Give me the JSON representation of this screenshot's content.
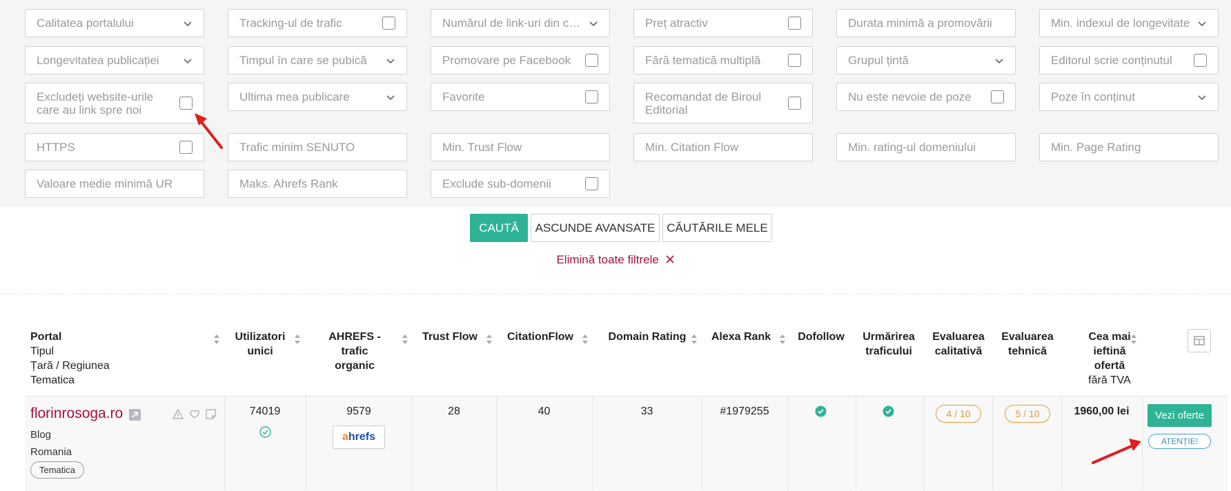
{
  "filters": {
    "row1": [
      "Calitatea portalului",
      "Tracking-ul de trafic",
      "Numărul de link-uri din co...",
      "Preț atractiv",
      "Durata minimă a promovării",
      "Min. indexul de longevitate"
    ],
    "row2": [
      "Longevitatea publicației",
      "Timpul în care se pubică",
      "Promovare pe Facebook",
      "Fără tematică multiplă",
      "Grupul țintă",
      "Editorul scrie conținutul"
    ],
    "row3": [
      "Excludeți website-urile care au link spre noi",
      "Ultima mea publicare",
      "Favorite",
      "Recomandat de Biroul Editorial",
      "Nu este nevoie de poze",
      "Poze în conținut"
    ],
    "row4": [
      "HTTPS",
      "Trafic minim SENUTO",
      "Min. Trust Flow",
      "Min. Citation Flow",
      "Min. rating-ul domeniului",
      "Min. Page Rating"
    ],
    "row5": [
      "Valoare medie minimă UR",
      "Maks. Ahrefs Rank",
      "Exclude sub-domenii"
    ]
  },
  "actions": {
    "search": "CAUTĂ",
    "hide_advanced": "ASCUNDE AVANSATE",
    "my_searches": "CĂUTĂRILE MELE",
    "clear_filters": "Elimină toate filtrele"
  },
  "table": {
    "headers": {
      "portal": "Portal",
      "type": "Tipul",
      "country": "Țară / Regiunea",
      "topic": "Tematica",
      "unique_users_1": "Utilizatori",
      "unique_users_2": "unici",
      "ahrefs_1": "AHREFS - trafic",
      "ahrefs_2": "organic",
      "trust_flow": "Trust Flow",
      "citation_flow": "CitationFlow",
      "domain_rating": "Domain Rating",
      "alexa": "Alexa Rank",
      "dofollow": "Dofollow",
      "tracking_1": "Urmărirea",
      "tracking_2": "traficului",
      "quality_1": "Evaluarea",
      "quality_2": "calitativă",
      "technical_1": "Evaluarea",
      "technical_2": "tehnică",
      "price_1": "Cea mai",
      "price_2": "ieftină",
      "price_3": "ofertă",
      "price_4": "fără TVA"
    },
    "row": {
      "portal": "florinrosoga.ro",
      "type": "Blog",
      "country": "Romania",
      "topic_tag": "Tematica",
      "unique_users": "74019",
      "ahrefs_traffic": "9579",
      "ahrefs_logo_a": "a",
      "ahrefs_logo_rest": "hrefs",
      "trust_flow": "28",
      "citation_flow": "40",
      "domain_rating": "33",
      "alexa": "#1979255",
      "quality": "4 / 10",
      "technical": "5 / 10",
      "price": "1960,00 lei",
      "offers_button": "Vezi oferte",
      "attention_button": "ATENȚIE!"
    }
  },
  "colors": {
    "accent": "#2eb396",
    "link": "#a4123f",
    "pill": "#e39a3b",
    "arrow": "#e01e1e"
  }
}
